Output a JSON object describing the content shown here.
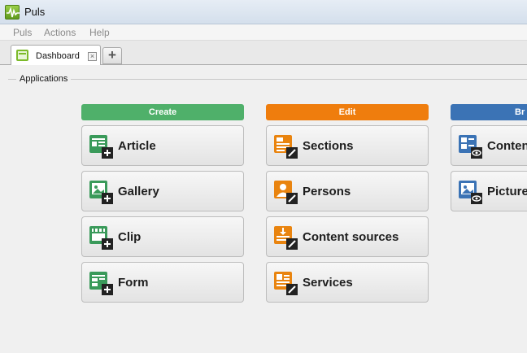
{
  "window": {
    "title": "Puls"
  },
  "menu": [
    "Puls",
    "Actions",
    "Help"
  ],
  "tabs": {
    "active": "Dashboard",
    "add": "+",
    "close": "×"
  },
  "group": {
    "label": "Applications"
  },
  "columns": [
    {
      "header": "Create",
      "color": "#4fb06a",
      "items": [
        {
          "label": "Article",
          "icon": "article-add-icon"
        },
        {
          "label": "Gallery",
          "icon": "gallery-add-icon"
        },
        {
          "label": "Clip",
          "icon": "clip-add-icon"
        },
        {
          "label": "Form",
          "icon": "form-add-icon"
        }
      ]
    },
    {
      "header": "Edit",
      "color": "#ef7d0d",
      "items": [
        {
          "label": "Sections",
          "icon": "sections-edit-icon"
        },
        {
          "label": "Persons",
          "icon": "persons-edit-icon"
        },
        {
          "label": "Content sources",
          "icon": "content-sources-edit-icon"
        },
        {
          "label": "Services",
          "icon": "services-edit-icon"
        }
      ]
    },
    {
      "header": "Br",
      "color": "#3b73b5",
      "items": [
        {
          "label": "Conten",
          "icon": "content-browse-icon"
        },
        {
          "label": "Picture",
          "icon": "picture-browse-icon"
        }
      ]
    }
  ]
}
